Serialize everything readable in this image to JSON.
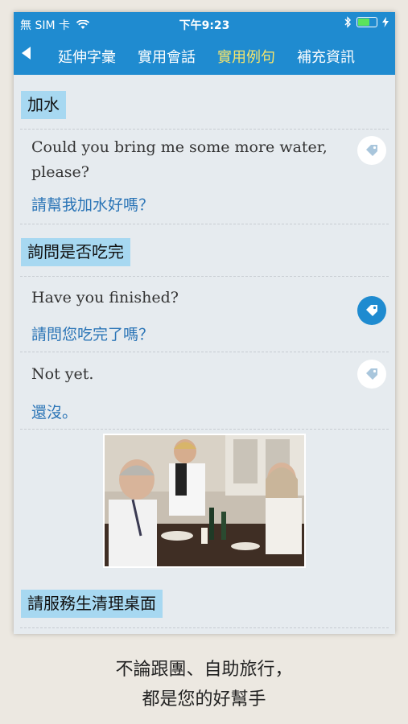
{
  "status_bar": {
    "carrier": "無 SIM 卡",
    "time": "下午9:23"
  },
  "nav": {
    "tabs": [
      {
        "label": "延伸字彙"
      },
      {
        "label": "實用會話"
      },
      {
        "label": "實用例句"
      },
      {
        "label": "補充資訊"
      }
    ],
    "active_tab": "實用例句"
  },
  "sections": [
    {
      "heading": "加水",
      "items": [
        {
          "en": "Could you bring me some more water, please?",
          "zh": "請幫我加水好嗎？",
          "tagged": false
        }
      ]
    },
    {
      "heading": "詢問是否吃完",
      "items": [
        {
          "en": "Have you finished?",
          "zh": "請問您吃完了嗎？",
          "tagged": true
        },
        {
          "en": "Not yet.",
          "zh": "還沒。",
          "tagged": false
        }
      ]
    },
    {
      "heading": "請服務生清理桌面",
      "items": []
    }
  ],
  "caption": {
    "line1": "不論跟團、自助旅行，",
    "line2": "都是您的好幫手"
  },
  "colors": {
    "accent": "#1f8bd0",
    "active_tab": "#f7e56b",
    "heading_bg": "#a7d8f1",
    "zh_text": "#2a74b6"
  }
}
